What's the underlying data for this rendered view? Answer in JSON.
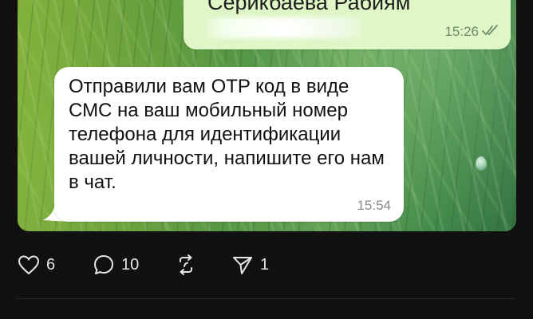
{
  "outgoing_message": {
    "sender_text": "Серикбаева Рабиям",
    "time": "15:26",
    "status": "read"
  },
  "incoming_message": {
    "text": "Отправили вам OTP код в виде СМС на ваш мобильный номер телефона для идентификации вашей личности, напишите его нам в чат.",
    "time": "15:54"
  },
  "actions": {
    "likes": "6",
    "replies": "10",
    "shares": "1"
  },
  "icons": {
    "like": "heart-icon",
    "reply": "comment-icon",
    "repost": "repost-icon",
    "share": "send-icon"
  },
  "colors": {
    "background": "#111111",
    "outgoing_bubble": "#dff6c6",
    "incoming_bubble": "#ffffff"
  }
}
